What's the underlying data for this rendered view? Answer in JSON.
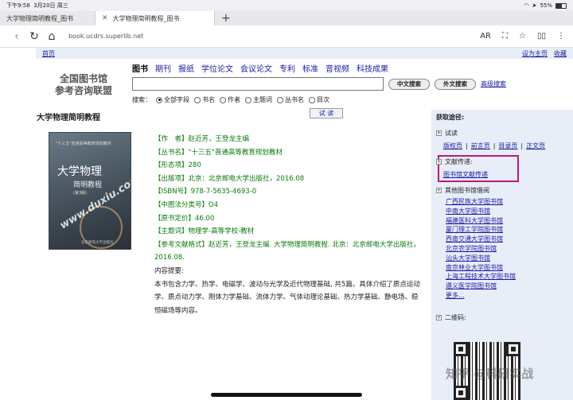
{
  "status": {
    "time": "下午9:58",
    "date": "3月20日 周三",
    "battery": "55%",
    "battery_level": 0.55
  },
  "tabs": [
    {
      "label": "大学物理简明教程_图书",
      "active": false
    },
    {
      "label": "大学物理简明教程_图书",
      "active": true
    }
  ],
  "address": {
    "url": "book.ucdrs.superlib.net",
    "reader_label": "AR"
  },
  "topnav": {
    "home": "首页",
    "set_home": "设为主页",
    "favorite": "收藏"
  },
  "logo": {
    "line1": "全国图书馆",
    "line2": "参考咨询联盟"
  },
  "categories": [
    "图书",
    "期刊",
    "报纸",
    "学位论文",
    "会议论文",
    "专利",
    "标准",
    "音视频",
    "科技成果"
  ],
  "search": {
    "value": "",
    "btn_cn": "中文搜索",
    "btn_foreign": "外文搜索",
    "advanced": "高级搜索"
  },
  "fields": {
    "label": "搜索：",
    "options": [
      "全部字段",
      "书名",
      "作者",
      "主题词",
      "丛书名",
      "目次"
    ],
    "selected": 0
  },
  "book": {
    "title": "大学物理简明教程",
    "try_read": "试 读",
    "cover": {
      "series": "\"十三五\"普通高等教育规划教材",
      "title": "大学物理",
      "subtitle": "简明教程",
      "edition": "(第3版)",
      "watermark": "www.duxiu.com",
      "publisher": "北京邮电大学出版社"
    },
    "details": [
      {
        "label": "【作　者】",
        "value": "赵近芳，王登龙主编"
      },
      {
        "label": "【丛书名】",
        "value": "\"十三五\"普通高等教育规划教材"
      },
      {
        "label": "【形态项】",
        "value": "280"
      },
      {
        "label": "【出版项】",
        "value": "北京：北京邮电大学出版社，2016.08"
      },
      {
        "label": "【ISBN号】",
        "value": "978-7-5635-4693-0"
      },
      {
        "label": "【中图法分类号】",
        "value": "O4"
      },
      {
        "label": "【原书定价】",
        "value": "46.00"
      },
      {
        "label": "【主题词】",
        "value": "物理学-高等学校-教材"
      },
      {
        "label": "【参考文献格式】",
        "value": "赵近芳，王登龙主编. 大学物理简明教程. 北京：北京邮电大学出版社，2016.08."
      }
    ],
    "summary_label": "内容提要:",
    "summary": "本书包含力学、热学、电磁学、波动与光学及近代物理基础, 共5篇。具体介绍了质点运动学、质点动力学、刚体力学基础、流体力学、气体动理论基础、热力学基础、静电场、稳恒磁场等内容。"
  },
  "sidebar": {
    "header": "获取途径:",
    "trial": "试读",
    "trial_links": [
      "版权页",
      "前言页",
      "目录页",
      "正文页"
    ],
    "delivery": "文献传递:",
    "delivery_link": "图书馆文献传递",
    "other": "其他图书馆借阅",
    "libraries": [
      "广西民族大学图书馆",
      "中南大学图书馆",
      "福建医科大学图书馆",
      "厦门理工学院图书馆",
      "西南交通大学图书馆",
      "北京农学院图书馆",
      "汕头大学图书馆",
      "南京林业大学图书馆",
      "上海工程技术大学图书馆",
      "遵义医学院图书馆",
      "更多..."
    ],
    "qr_label": "二维码:"
  },
  "watermark": "知乎 @科研实战"
}
